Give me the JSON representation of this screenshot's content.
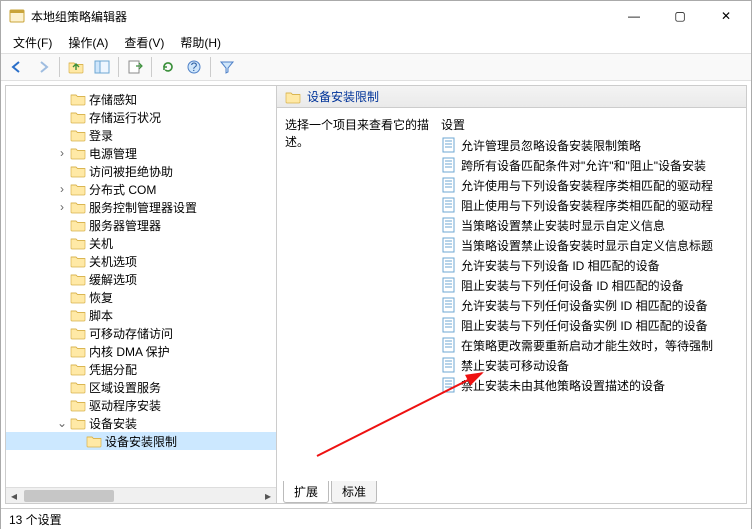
{
  "window": {
    "title": "本地组策略编辑器",
    "minimize": "—",
    "maximize": "▢",
    "close": "✕"
  },
  "menu": {
    "file": "文件(F)",
    "action": "操作(A)",
    "view": "查看(V)",
    "help": "帮助(H)"
  },
  "tree": [
    {
      "label": "存储感知",
      "depth": 3,
      "expando": ""
    },
    {
      "label": "存储运行状况",
      "depth": 3,
      "expando": ""
    },
    {
      "label": "登录",
      "depth": 3,
      "expando": ""
    },
    {
      "label": "电源管理",
      "depth": 3,
      "expando": "›"
    },
    {
      "label": "访问被拒绝协助",
      "depth": 3,
      "expando": ""
    },
    {
      "label": "分布式 COM",
      "depth": 3,
      "expando": "›"
    },
    {
      "label": "服务控制管理器设置",
      "depth": 3,
      "expando": "›"
    },
    {
      "label": "服务器管理器",
      "depth": 3,
      "expando": ""
    },
    {
      "label": "关机",
      "depth": 3,
      "expando": ""
    },
    {
      "label": "关机选项",
      "depth": 3,
      "expando": ""
    },
    {
      "label": "缓解选项",
      "depth": 3,
      "expando": ""
    },
    {
      "label": "恢复",
      "depth": 3,
      "expando": ""
    },
    {
      "label": "脚本",
      "depth": 3,
      "expando": ""
    },
    {
      "label": "可移动存储访问",
      "depth": 3,
      "expando": ""
    },
    {
      "label": "内核 DMA 保护",
      "depth": 3,
      "expando": ""
    },
    {
      "label": "凭据分配",
      "depth": 3,
      "expando": ""
    },
    {
      "label": "区域设置服务",
      "depth": 3,
      "expando": ""
    },
    {
      "label": "驱动程序安装",
      "depth": 3,
      "expando": ""
    },
    {
      "label": "设备安装",
      "depth": 3,
      "expando": "⌄",
      "expanded": true
    },
    {
      "label": "设备安装限制",
      "depth": 4,
      "expando": "",
      "selected": true
    }
  ],
  "right": {
    "header": "设备安装限制",
    "desc": "选择一个项目来查看它的描述。",
    "col_head": "设置",
    "items": [
      "允许管理员忽略设备安装限制策略",
      "跨所有设备匹配条件对\"允许\"和\"阻止\"设备安装",
      "允许使用与下列设备安装程序类相匹配的驱动程",
      "阻止使用与下列设备安装程序类相匹配的驱动程",
      "当策略设置禁止安装时显示自定义信息",
      "当策略设置禁止设备安装时显示自定义信息标题",
      "允许安装与下列设备 ID 相匹配的设备",
      "阻止安装与下列任何设备 ID 相匹配的设备",
      "允许安装与下列任何设备实例 ID 相匹配的设备",
      "阻止安装与下列任何设备实例 ID 相匹配的设备",
      "在策略更改需要重新启动才能生效时，等待强制",
      "禁止安装可移动设备",
      "禁止安装未由其他策略设置描述的设备"
    ]
  },
  "tabs": {
    "extended": "扩展",
    "standard": "标准"
  },
  "status": "13 个设置"
}
